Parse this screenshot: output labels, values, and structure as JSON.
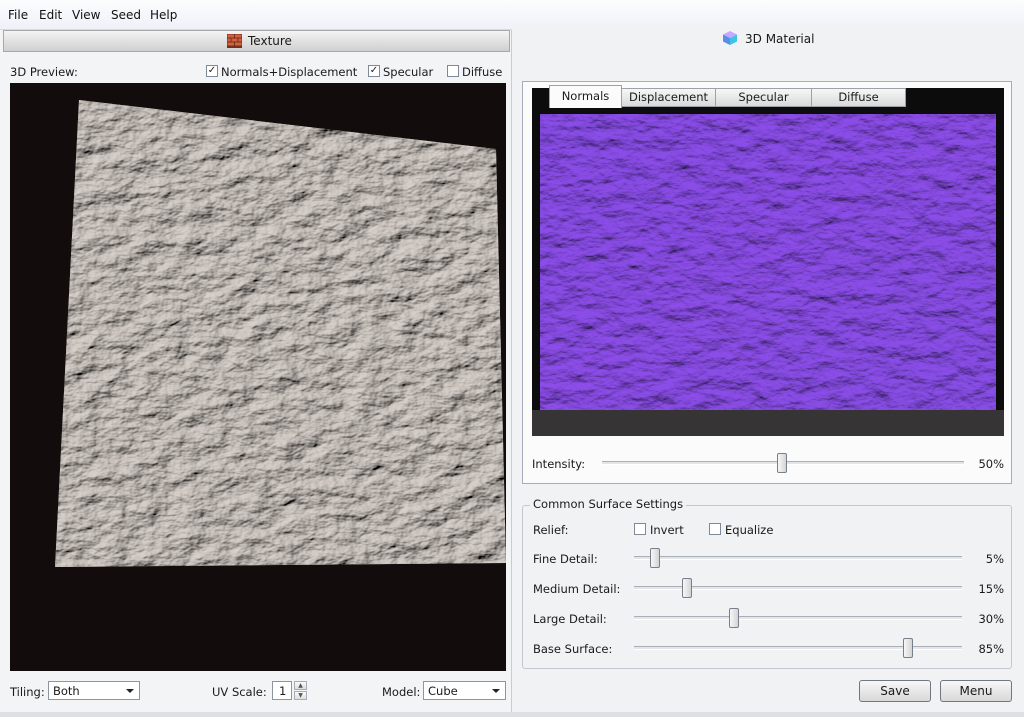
{
  "menu": {
    "items": [
      "File",
      "Edit",
      "View",
      "Seed",
      "Help"
    ]
  },
  "left": {
    "title": "Texture",
    "preview_label": "3D Preview:",
    "options": [
      {
        "label": "Normals+Displacement",
        "checked": true
      },
      {
        "label": "Specular",
        "checked": true
      },
      {
        "label": "Diffuse",
        "checked": false
      }
    ],
    "tiling": {
      "label": "Tiling:",
      "value": "Both"
    },
    "uv_scale": {
      "label": "UV Scale:",
      "value": "1"
    },
    "model": {
      "label": "Model:",
      "value": "Cube"
    }
  },
  "right": {
    "title": "3D Material",
    "tabs": [
      {
        "label": "Normals",
        "active": true
      },
      {
        "label": "Displacement",
        "active": false
      },
      {
        "label": "Specular",
        "active": false
      },
      {
        "label": "Diffuse",
        "active": false
      }
    ],
    "intensity": {
      "label": "Intensity:",
      "value": 50,
      "display": "50%"
    },
    "common": {
      "title": "Common Surface Settings",
      "relief_label": "Relief:",
      "invert": {
        "label": "Invert",
        "checked": false
      },
      "equalize": {
        "label": "Equalize",
        "checked": false
      },
      "sliders": [
        {
          "label": "Fine Detail:",
          "value": 5,
          "display": "5%"
        },
        {
          "label": "Medium Detail:",
          "value": 15,
          "display": "15%"
        },
        {
          "label": "Large Detail:",
          "value": 30,
          "display": "30%"
        },
        {
          "label": "Base Surface:",
          "value": 85,
          "display": "85%"
        }
      ]
    },
    "buttons": {
      "save": "Save",
      "menu": "Menu"
    }
  },
  "icons": {
    "texture": "brick-icon",
    "material": "cube-icon",
    "dropdown": "chevron-down-icon",
    "spin_up": "arrow-up-icon",
    "spin_down": "arrow-down-icon"
  },
  "colors": {
    "preview_bg": "#120c0c",
    "normals_blue": "#8a7cf2",
    "normals_purple": "#b25ee8",
    "stone": "#8a827c"
  }
}
